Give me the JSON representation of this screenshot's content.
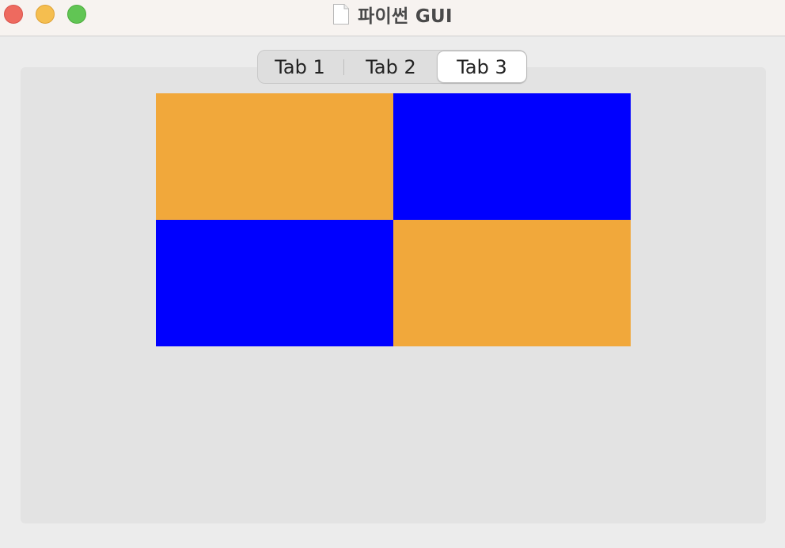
{
  "window": {
    "title": "파이썬 GUI",
    "title_icon": "document-icon"
  },
  "tabs": [
    {
      "label": "Tab 1",
      "selected": false
    },
    {
      "label": "Tab 2",
      "selected": false
    },
    {
      "label": "Tab 3",
      "selected": true
    }
  ],
  "canvas": {
    "cells": [
      {
        "color": "#f1a83b"
      },
      {
        "color": "#0000ff"
      },
      {
        "color": "#0000ff"
      },
      {
        "color": "#f1a83b"
      }
    ]
  },
  "colors": {
    "orange": "#f1a83b",
    "blue": "#0000ff"
  }
}
